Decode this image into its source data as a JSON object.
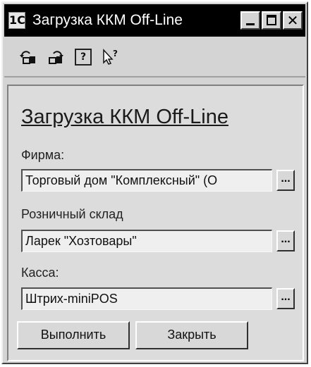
{
  "window": {
    "title": "Загрузка ККМ Off-Line",
    "app_icon": "1С"
  },
  "toolbar": {
    "icons": [
      "undo-lock-icon",
      "redo-lock-icon",
      "help-icon",
      "context-help-icon"
    ],
    "help_glyph": "?"
  },
  "form": {
    "heading": "Загрузка ККМ Off-Line",
    "firm_label": "Фирма:",
    "firm_value": "Торговый дом \"Комплексный\" (О",
    "warehouse_label": "Розничный склад",
    "warehouse_value": "Ларек \"Хозтовары\"",
    "register_label": "Касса:",
    "register_value": "Штрих-miniPOS",
    "ellipsis": "..."
  },
  "buttons": {
    "execute_label": "Выполнить",
    "close_label": "Закрыть"
  }
}
